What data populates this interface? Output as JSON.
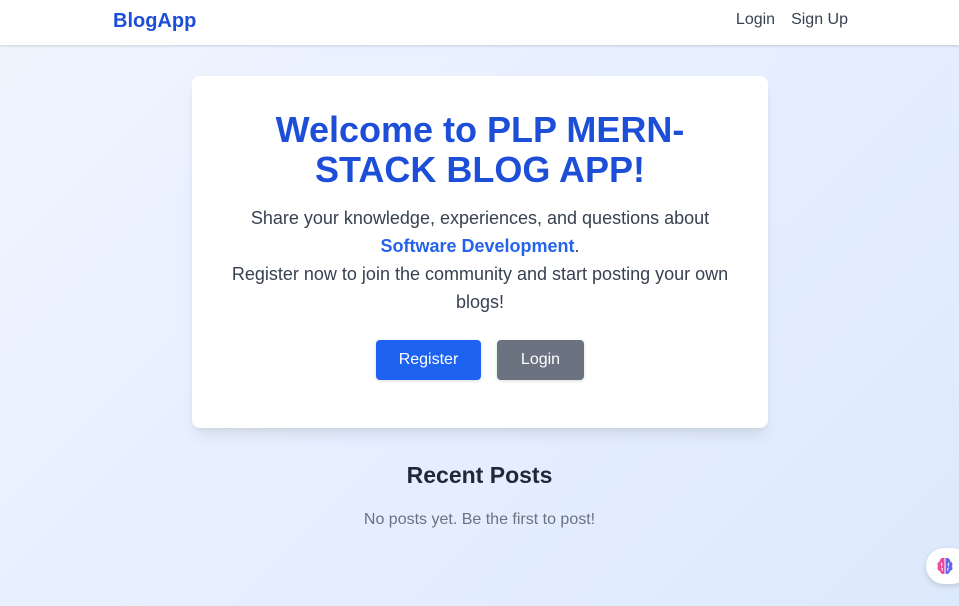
{
  "navbar": {
    "brand": "BlogApp",
    "links": [
      "Login",
      "Sign Up"
    ]
  },
  "hero": {
    "title_line1": "Welcome to PLP MERN-",
    "title_line2": "STACK BLOG APP!",
    "text_part1": "Share your knowledge, experiences, and questions about ",
    "highlight": "Software Development",
    "text_part2": ".",
    "text_line2": "Register now to join the community and start posting your own blogs!",
    "register_button": "Register",
    "login_button": "Login"
  },
  "recent_posts": {
    "title": "Recent Posts",
    "empty_message": "No posts yet. Be the first to post!"
  },
  "widget": {
    "icon": "brain-icon"
  },
  "colors": {
    "brand": "#1d4ed8",
    "primary_button": "#1d62f0",
    "secondary_button": "#6b7280",
    "highlight": "#2563eb"
  }
}
